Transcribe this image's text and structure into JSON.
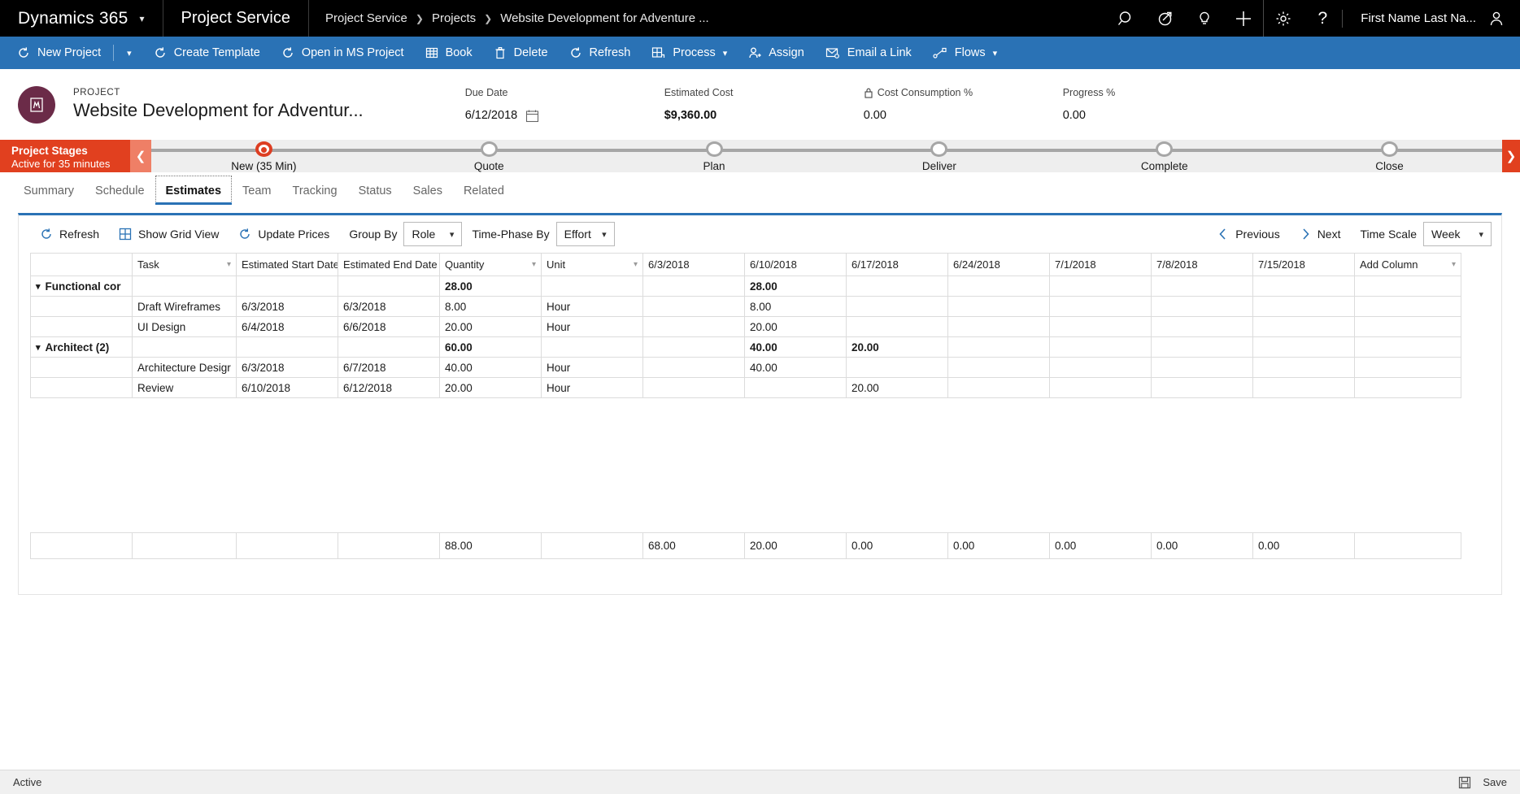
{
  "topnav": {
    "brand": "Dynamics 365",
    "app_name": "Project Service",
    "breadcrumb": [
      "Project Service",
      "Projects",
      "Website Development for Adventure ..."
    ],
    "icons": [
      "search-icon",
      "assistant-icon",
      "lightbulb-icon",
      "plus-icon",
      "gear-icon",
      "help-icon"
    ],
    "user_name": "First Name Last Na..."
  },
  "commandbar": {
    "items": [
      {
        "label": "New Project",
        "icon": "refresh-project-icon",
        "has_split": true
      },
      {
        "label": "Create Template",
        "icon": "refresh-project-icon"
      },
      {
        "label": "Open in MS Project",
        "icon": "refresh-project-icon"
      },
      {
        "label": "Book",
        "icon": "grid-icon"
      },
      {
        "label": "Delete",
        "icon": "trash-icon"
      },
      {
        "label": "Refresh",
        "icon": "refresh-icon"
      },
      {
        "label": "Process",
        "icon": "process-icon",
        "has_caret": true
      },
      {
        "label": "Assign",
        "icon": "assign-user-icon"
      },
      {
        "label": "Email a Link",
        "icon": "email-icon"
      },
      {
        "label": "Flows",
        "icon": "flows-icon",
        "has_caret": true
      }
    ]
  },
  "project_header": {
    "eyebrow": "PROJECT",
    "title": "Website Development for Adventur...",
    "fields": [
      {
        "label": "Due Date",
        "value": "6/12/2018",
        "icon": "calendar-icon",
        "bold": false
      },
      {
        "label": "Estimated Cost",
        "value": "$9,360.00",
        "bold": true
      },
      {
        "label": "Cost Consumption %",
        "value": "0.00",
        "icon": "lock-icon",
        "bold": false
      },
      {
        "label": "Progress %",
        "value": "0.00",
        "bold": false
      }
    ]
  },
  "stage_bar": {
    "title": "Project Stages",
    "subtitle": "Active for 35 minutes",
    "stages": [
      {
        "label": "New  (35 Min)",
        "active": true
      },
      {
        "label": "Quote",
        "active": false
      },
      {
        "label": "Plan",
        "active": false
      },
      {
        "label": "Deliver",
        "active": false
      },
      {
        "label": "Complete",
        "active": false
      },
      {
        "label": "Close",
        "active": false
      }
    ]
  },
  "tabs": [
    {
      "label": "Summary",
      "active": false
    },
    {
      "label": "Schedule",
      "active": false
    },
    {
      "label": "Estimates",
      "active": true
    },
    {
      "label": "Team",
      "active": false
    },
    {
      "label": "Tracking",
      "active": false
    },
    {
      "label": "Status",
      "active": false
    },
    {
      "label": "Sales",
      "active": false
    },
    {
      "label": "Related",
      "active": false
    }
  ],
  "grid_toolbar": {
    "refresh": "Refresh",
    "show_grid_view": "Show Grid View",
    "update_prices": "Update Prices",
    "group_by_label": "Group By",
    "group_by_value": "Role",
    "time_phase_label": "Time-Phase By",
    "time_phase_value": "Effort",
    "previous": "Previous",
    "next": "Next",
    "time_scale_label": "Time Scale",
    "time_scale_value": "Week"
  },
  "grid": {
    "columns": [
      {
        "label": "",
        "caret": false
      },
      {
        "label": "Task",
        "caret": true
      },
      {
        "label": "Estimated Start Date",
        "caret": true
      },
      {
        "label": "Estimated End Date",
        "caret": true
      },
      {
        "label": "Quantity",
        "caret": true
      },
      {
        "label": "Unit",
        "caret": true
      },
      {
        "label": "6/3/2018",
        "caret": false
      },
      {
        "label": "6/10/2018",
        "caret": false
      },
      {
        "label": "6/17/2018",
        "caret": false
      },
      {
        "label": "6/24/2018",
        "caret": false
      },
      {
        "label": "7/1/2018",
        "caret": false
      },
      {
        "label": "7/8/2018",
        "caret": false
      },
      {
        "label": "7/15/2018",
        "caret": false
      },
      {
        "label": "Add Column",
        "caret": true
      }
    ],
    "rows": [
      {
        "type": "group",
        "group": "Functional cor",
        "task": "",
        "start": "",
        "end": "",
        "quantity": "28.00",
        "unit": "",
        "w1": "",
        "w2": "28.00",
        "w3": "",
        "w4": "",
        "w5": "",
        "w6": "",
        "w7": "",
        "w8": ""
      },
      {
        "type": "detail",
        "group": "",
        "task": "Draft Wireframes",
        "start": "6/3/2018",
        "end": "6/3/2018",
        "quantity": "8.00",
        "unit": "Hour",
        "w1": "",
        "w2": "8.00",
        "w3": "",
        "w4": "",
        "w5": "",
        "w6": "",
        "w7": "",
        "w8": ""
      },
      {
        "type": "detail",
        "group": "",
        "task": "UI Design",
        "start": "6/4/2018",
        "end": "6/6/2018",
        "quantity": "20.00",
        "unit": "Hour",
        "w1": "",
        "w2": "20.00",
        "w3": "",
        "w4": "",
        "w5": "",
        "w6": "",
        "w7": "",
        "w8": ""
      },
      {
        "type": "group",
        "group": "Architect (2)",
        "task": "",
        "start": "",
        "end": "",
        "quantity": "60.00",
        "unit": "",
        "w1": "",
        "w2": "40.00",
        "w3": "20.00",
        "w4": "",
        "w5": "",
        "w6": "",
        "w7": "",
        "w8": ""
      },
      {
        "type": "detail",
        "group": "",
        "task": "Architecture Desigr",
        "start": "6/3/2018",
        "end": "6/7/2018",
        "quantity": "40.00",
        "unit": "Hour",
        "w1": "",
        "w2": "40.00",
        "w3": "",
        "w4": "",
        "w5": "",
        "w6": "",
        "w7": "",
        "w8": ""
      },
      {
        "type": "detail",
        "group": "",
        "task": "Review",
        "start": "6/10/2018",
        "end": "6/12/2018",
        "quantity": "20.00",
        "unit": "Hour",
        "w1": "",
        "w2": "",
        "w3": "20.00",
        "w4": "",
        "w5": "",
        "w6": "",
        "w7": "",
        "w8": ""
      }
    ],
    "totals": {
      "group": "",
      "task": "",
      "start": "",
      "end": "",
      "quantity": "88.00",
      "unit": "",
      "w2": "68.00",
      "w3": "20.00",
      "w4": "0.00",
      "w5": "0.00",
      "w6": "0.00",
      "w7": "0.00",
      "w8": "0.00"
    }
  },
  "statusbar": {
    "state": "Active",
    "save_label": "Save",
    "save_icon": "save-disk-icon"
  },
  "colors": {
    "topnav_bg": "#000000",
    "command_bar_bg": "#2a72b5",
    "accent": "#2a72b5",
    "stage_red": "#e1401f",
    "avatar": "#6b2b48"
  }
}
